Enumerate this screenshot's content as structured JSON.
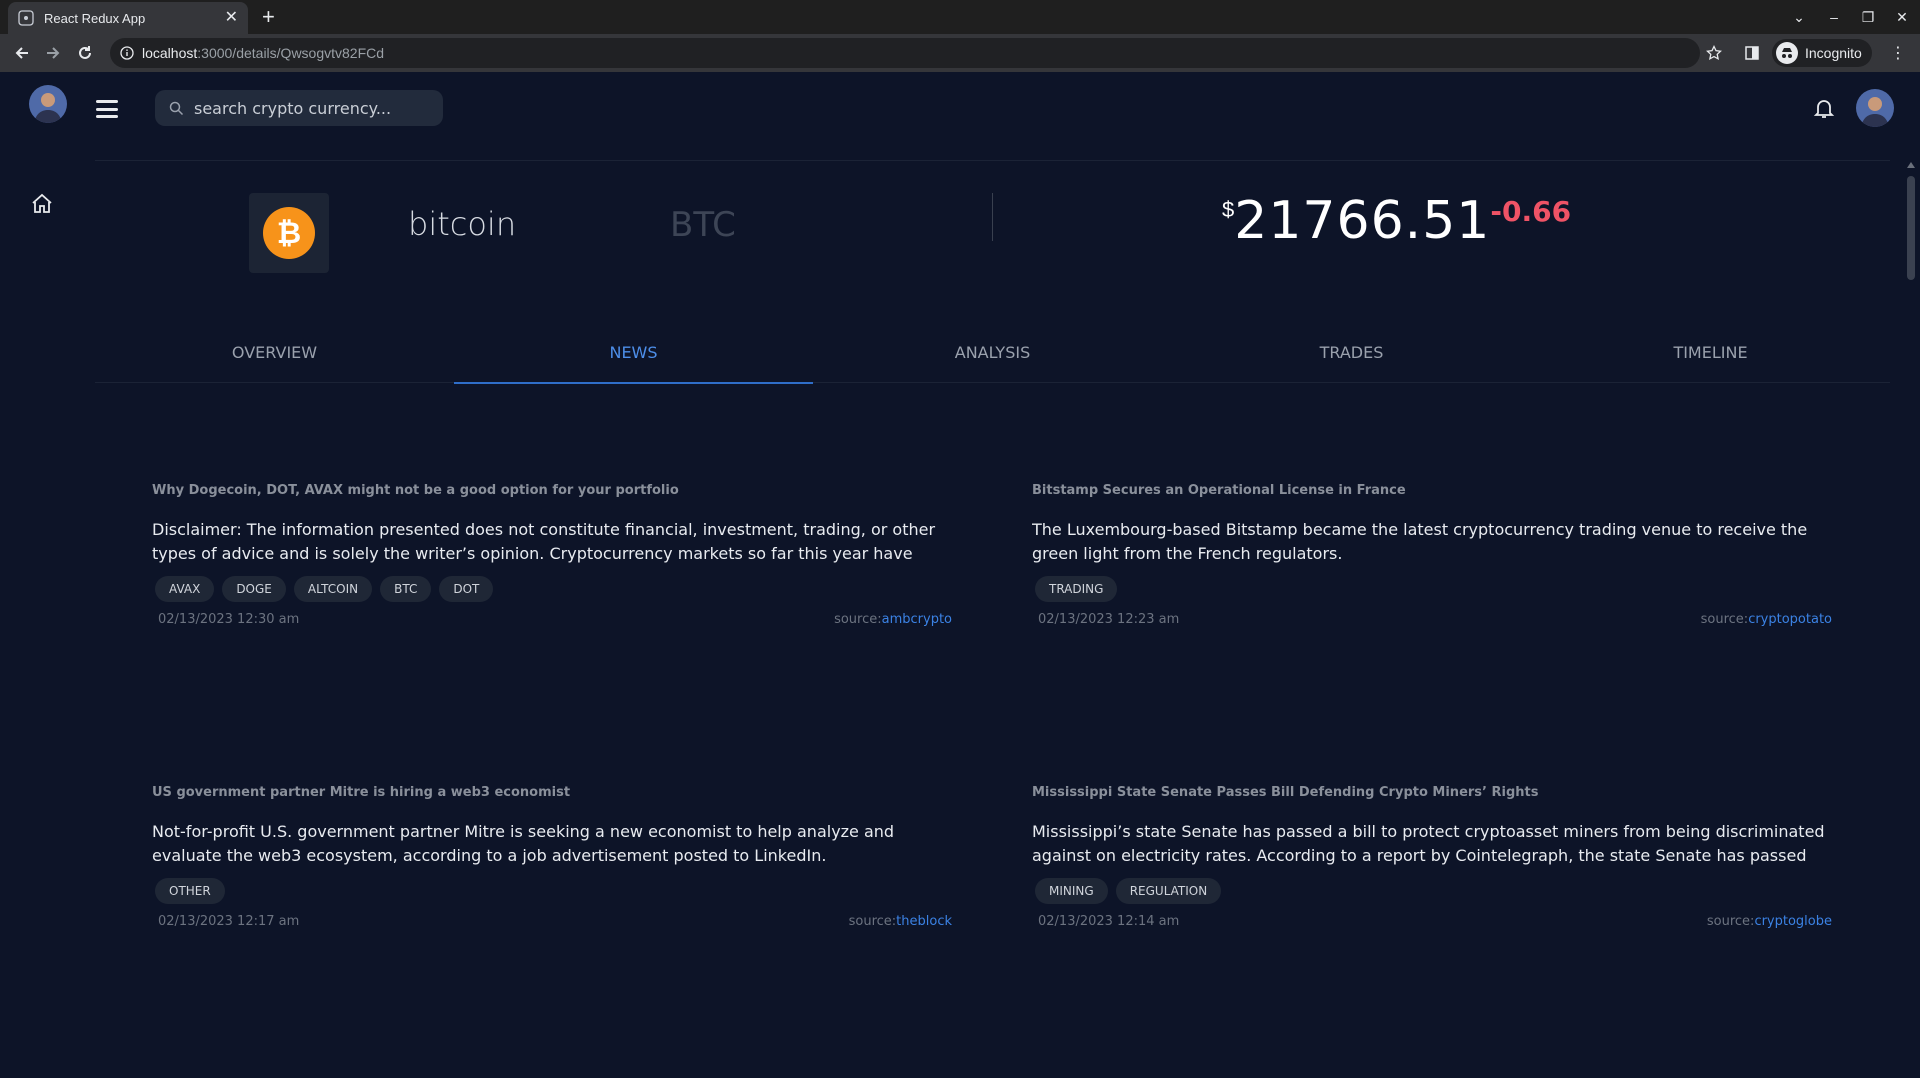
{
  "browser": {
    "tab_title": "React Redux App",
    "url_host": "localhost",
    "url_rest": ":3000/details/Qwsogvtv82FCd",
    "incognito_label": "Incognito"
  },
  "header": {
    "search_placeholder": "search crypto currency..."
  },
  "coin": {
    "name": "bitcoin",
    "symbol": "BTC",
    "currency_symbol": "$",
    "price": "21766.51",
    "change": "-0.66",
    "colors": {
      "negative": "#ef5366",
      "accent": "#4d8ee8",
      "bitcoin": "#f7931a"
    }
  },
  "tabs": [
    "OVERVIEW",
    "NEWS",
    "ANALYSIS",
    "TRADES",
    "TIMELINE"
  ],
  "active_tab": "NEWS",
  "news": [
    {
      "title": "Why Dogecoin, DOT, AVAX might not be a good option for your portfolio",
      "body": "Disclaimer: The information presented does not constitute financial, investment, trading, or other types of advice and is solely the writer’s opinion. Cryptocurrency markets so far this year have seen a significant uptre...",
      "tags": [
        "AVAX",
        "DOGE",
        "ALTCOIN",
        "BTC",
        "DOT"
      ],
      "date": "02/13/2023 12:30 am",
      "source_label": "source:",
      "source": "ambcrypto"
    },
    {
      "title": "Bitstamp Secures an Operational License in France",
      "body": "The Luxembourg-based Bitstamp became the latest cryptocurrency trading venue to receive the green light from the French regulators.",
      "tags": [
        "TRADING"
      ],
      "date": "02/13/2023 12:23 am",
      "source_label": "source:",
      "source": "cryptopotato"
    },
    {
      "title": "US government partner Mitre is hiring a web3 economist",
      "body": "Not-for-profit U.S. government partner Mitre is seeking a new economist to help analyze and evaluate the web3 ecosystem, according to a job advertisement posted to LinkedIn.",
      "tags": [
        "OTHER"
      ],
      "date": "02/13/2023 12:17 am",
      "source_label": "source:",
      "source": "theblock"
    },
    {
      "title": "Mississippi State Senate Passes Bill Defending Crypto Miners’ Rights",
      "body": "Mississippi’s state Senate has passed a bill to protect cryptoasset miners from being discriminated against on electricity rates. According to a report by Cointelegraph, the state Senate has passed the Mississippi Digita...",
      "tags": [
        "MINING",
        "REGULATION"
      ],
      "date": "02/13/2023 12:14 am",
      "source_label": "source:",
      "source": "cryptoglobe"
    }
  ]
}
